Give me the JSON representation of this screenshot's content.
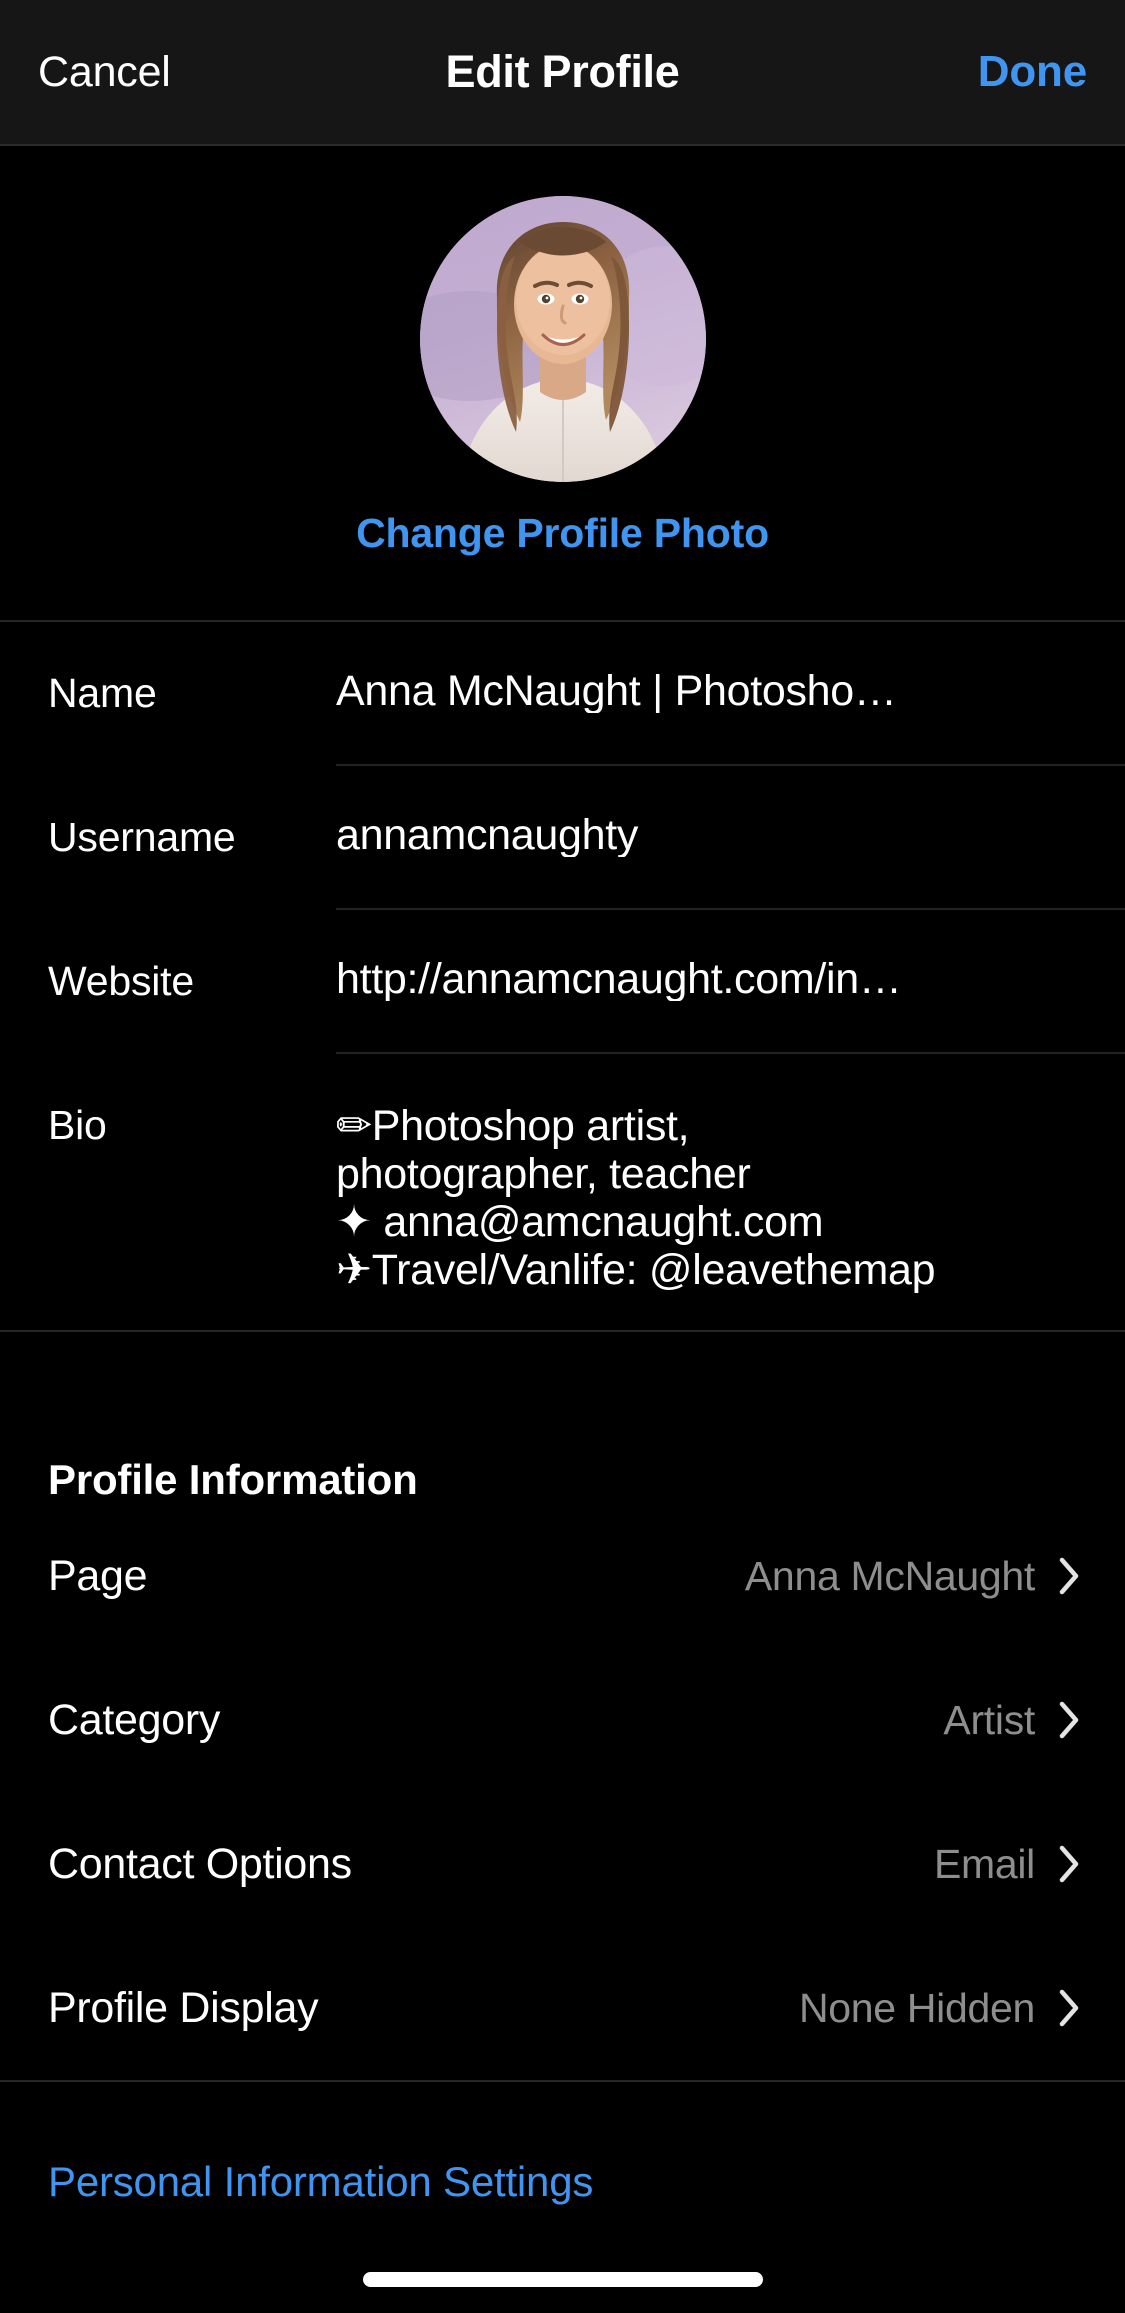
{
  "navbar": {
    "cancel_label": "Cancel",
    "title": "Edit Profile",
    "done_label": "Done"
  },
  "photo": {
    "change_photo_label": "Change Profile Photo",
    "avatar_alt": "profile-photo"
  },
  "fields": [
    {
      "label": "Name",
      "value": "Anna McNaught | Photosho…"
    },
    {
      "label": "Username",
      "value": "annamcnaughty"
    },
    {
      "label": "Website",
      "value": "http://annamcnaught.com/in…"
    }
  ],
  "bio": {
    "label": "Bio",
    "lines": [
      {
        "icon": "pencil-icon",
        "glyph": "✏︎",
        "text": "Photoshop artist,"
      },
      {
        "icon": "",
        "glyph": "",
        "text": "photographer, teacher"
      },
      {
        "icon": "sparkle-icon",
        "glyph": "✦",
        "text": " anna@amcnaught.com"
      },
      {
        "icon": "airplane-icon",
        "glyph": "✈︎",
        "text": "Travel/Vanlife:  @leavethemap"
      }
    ]
  },
  "profile_information": {
    "section_title": "Profile Information",
    "rows": [
      {
        "label": "Page",
        "value": "Anna McNaught"
      },
      {
        "label": "Category",
        "value": "Artist"
      },
      {
        "label": "Contact Options",
        "value": "Email"
      },
      {
        "label": "Profile Display",
        "value": "None Hidden"
      }
    ]
  },
  "footer": {
    "personal_info_settings_label": "Personal Information Settings"
  },
  "colors": {
    "background": "#000000",
    "navbar_background": "#161616",
    "accent_blue": "#3f95f0",
    "primary_text": "#ffffff",
    "secondary_text": "#8e8e8e",
    "divider": "#262626"
  }
}
